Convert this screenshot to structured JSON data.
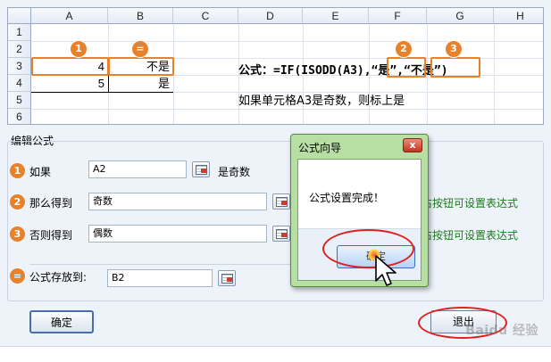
{
  "sheet": {
    "columns": [
      "A",
      "B",
      "C",
      "D",
      "E",
      "F",
      "G",
      "H"
    ],
    "rows": [
      "1",
      "2",
      "3",
      "4",
      "5",
      "6"
    ],
    "cells": {
      "a3": "4",
      "b3": "不是",
      "a4": "5",
      "b4": "是"
    },
    "badges": [
      "1",
      "="
    ],
    "formula": {
      "prefix": "公式：=IF(ISODD(A3),",
      "arg2": "“是”",
      "comma": ",",
      "arg3": "“不是”",
      "suffix": ")",
      "badge2": "2",
      "badge3": "3"
    },
    "note": "如果单元格A3是奇数，则标上是"
  },
  "editor": {
    "section_title": "编辑公式",
    "rows": [
      {
        "badge": "1",
        "label": "如果",
        "value": "A2",
        "after": "是奇数"
      },
      {
        "badge": "2",
        "label": "那么得到",
        "value": "奇数",
        "after": "右按钮可设置表达式"
      },
      {
        "badge": "3",
        "label": "否则得到",
        "value": "偶数",
        "after": "右按钮可设置表达式"
      },
      {
        "badge": "=",
        "label": "公式存放到:",
        "value": "B2"
      }
    ],
    "ok_label": "确定",
    "exit_label": "退出"
  },
  "popup": {
    "title": "公式向导",
    "close": "x",
    "message": "公式设置完成！",
    "ok_label": "确定"
  },
  "watermark": "Baidu 经验",
  "colors": {
    "accent_orange": "#e8822a",
    "highlight_red": "#e02020",
    "popup_green": "#b7dfa3",
    "hint_green": "#1a7a1a"
  }
}
